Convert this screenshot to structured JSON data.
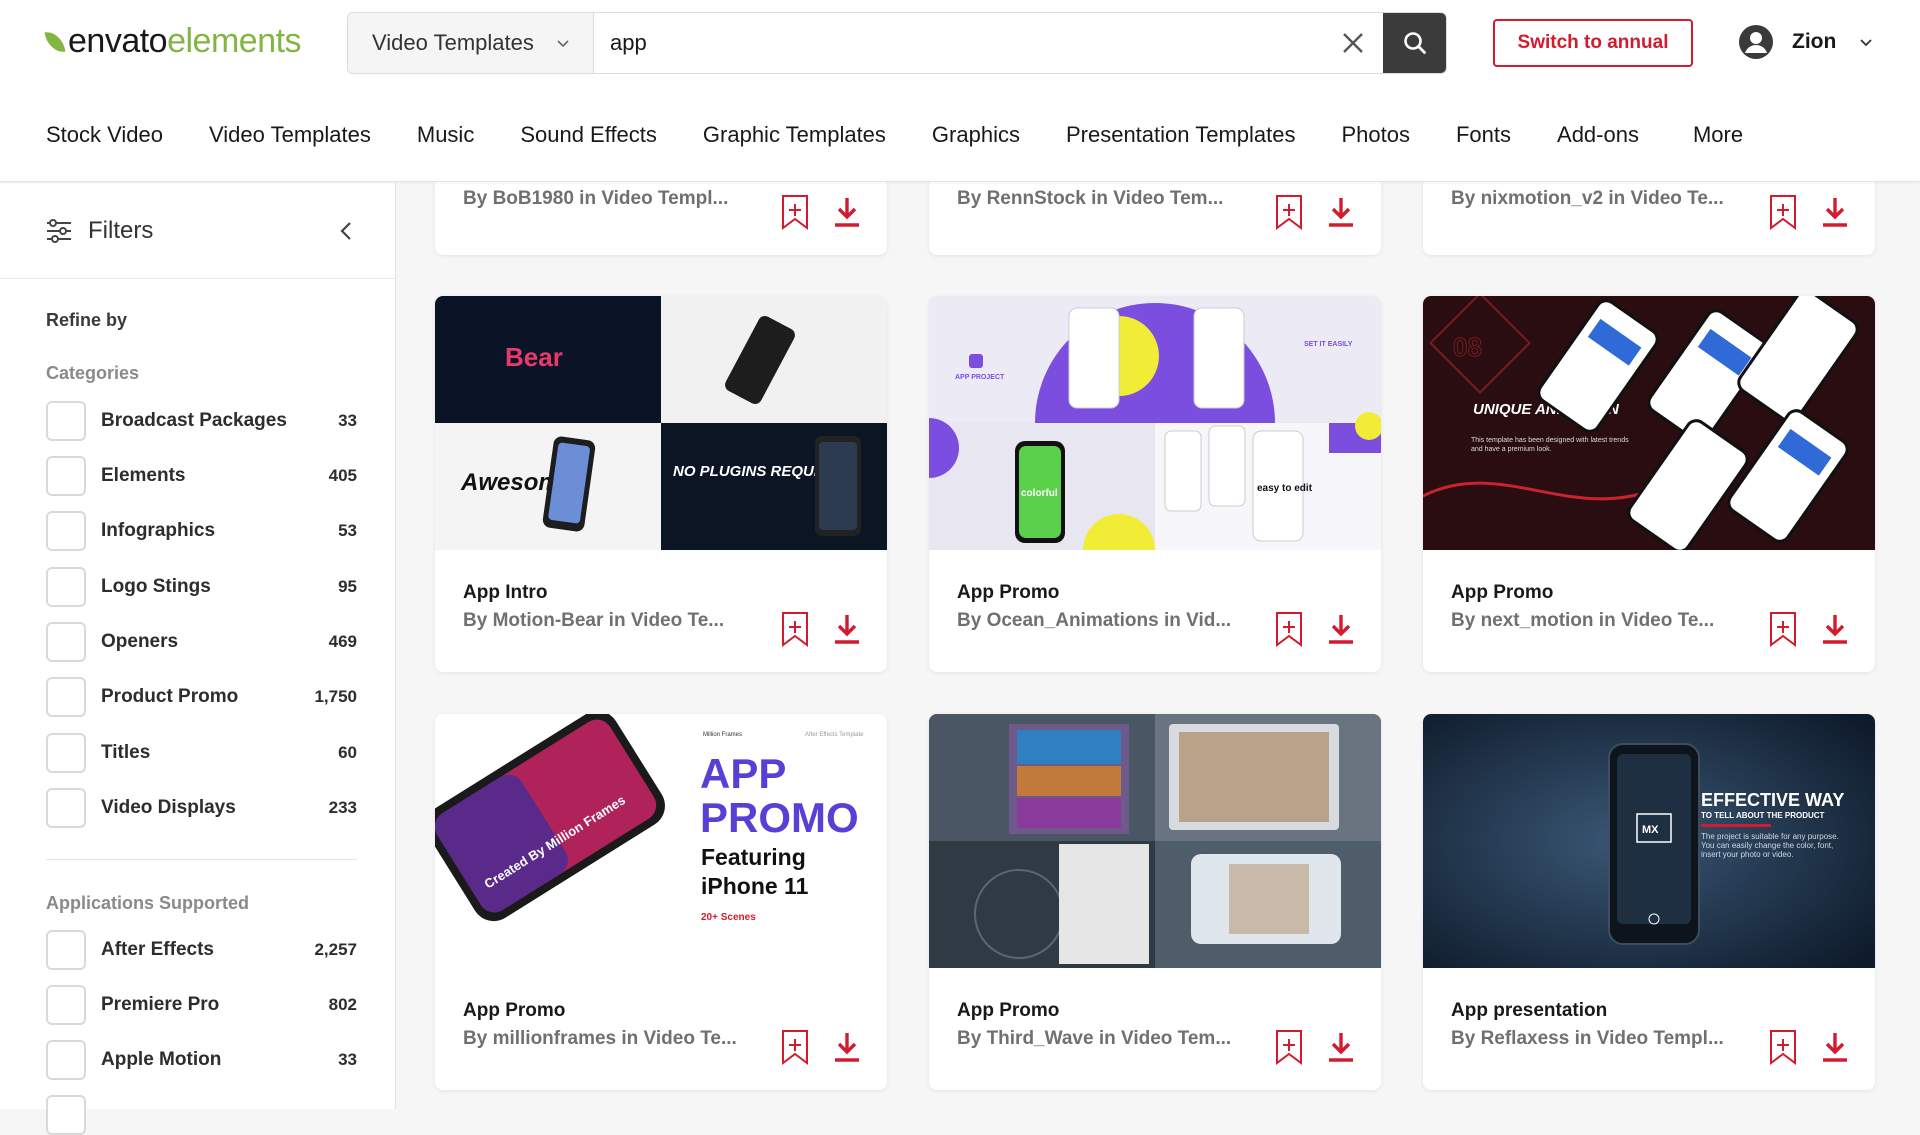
{
  "brand": {
    "word1": "envato",
    "word2": "elements",
    "accent": "#82b541",
    "icon": "leaf-icon"
  },
  "search": {
    "scope": "Video Templates",
    "query": "app"
  },
  "header": {
    "annual_label": "Switch to annual",
    "user_name": "Zion"
  },
  "nav": [
    "Stock Video",
    "Video Templates",
    "Music",
    "Sound Effects",
    "Graphic Templates",
    "Graphics",
    "Presentation Templates",
    "Photos",
    "Fonts",
    "Add-ons",
    "More"
  ],
  "sidebar": {
    "title": "Filters",
    "refine": "Refine by",
    "categories_title": "Categories",
    "categories": [
      {
        "label": "Broadcast Packages",
        "count": "33"
      },
      {
        "label": "Elements",
        "count": "405"
      },
      {
        "label": "Infographics",
        "count": "53"
      },
      {
        "label": "Logo Stings",
        "count": "95"
      },
      {
        "label": "Openers",
        "count": "469"
      },
      {
        "label": "Product Promo",
        "count": "1,750"
      },
      {
        "label": "Titles",
        "count": "60"
      },
      {
        "label": "Video Displays",
        "count": "233"
      }
    ],
    "apps_title": "Applications Supported",
    "apps": [
      {
        "label": "After Effects",
        "count": "2,257"
      },
      {
        "label": "Premiere Pro",
        "count": "802"
      },
      {
        "label": "Apple Motion",
        "count": "33"
      }
    ]
  },
  "top_row": [
    {
      "by": "By BoB1980 in Video Templ..."
    },
    {
      "by": "By RennStock in Video Tem..."
    },
    {
      "by": "By nixmotion_v2 in Video Te..."
    }
  ],
  "cards": [
    {
      "title": "App Intro",
      "by": "By Motion-Bear in Video Te...",
      "thumb": {
        "t1": "Bear",
        "t2": "Awesome",
        "t3": "NO PLUGINS REQUIRED"
      }
    },
    {
      "title": "App Promo",
      "by": "By Ocean_Animations in Vid...",
      "thumb": {
        "t1": "APP PROJECT",
        "t2": "SET IT EASILY",
        "t3": "colorful",
        "t4": "easy to edit"
      }
    },
    {
      "title": "App Promo",
      "by": "By next_motion in Video Te...",
      "thumb": {
        "t1": "08",
        "t2": "UNIQUE ANIMATION",
        "t3": "This template has been designed with latest trends and have a premium look."
      }
    },
    {
      "title": "App Promo",
      "by": "By millionframes in Video Te...",
      "thumb": {
        "t1": "APP",
        "t2": "PROMO",
        "t3": "Featuring",
        "t4": "iPhone 11",
        "t5": "20+ Scenes",
        "t6": "Created By Million Frames",
        "t7": "Million Frames",
        "t8": "After Effects Template"
      }
    },
    {
      "title": "App Promo",
      "by": "By Third_Wave in Video Tem...",
      "thumb": {}
    },
    {
      "title": "App presentation",
      "by": "By Reflaxess in Video Templ...",
      "thumb": {
        "t1": "EFFECTIVE WAY",
        "t2": "TO TELL ABOUT THE PRODUCT",
        "t3": "The project is suitable for any purpose. You can easily change the color, font, insert your photo or video.",
        "t4": "MX"
      }
    }
  ],
  "colors": {
    "red": "#d21b2f",
    "dark": "#3b3b3b"
  }
}
